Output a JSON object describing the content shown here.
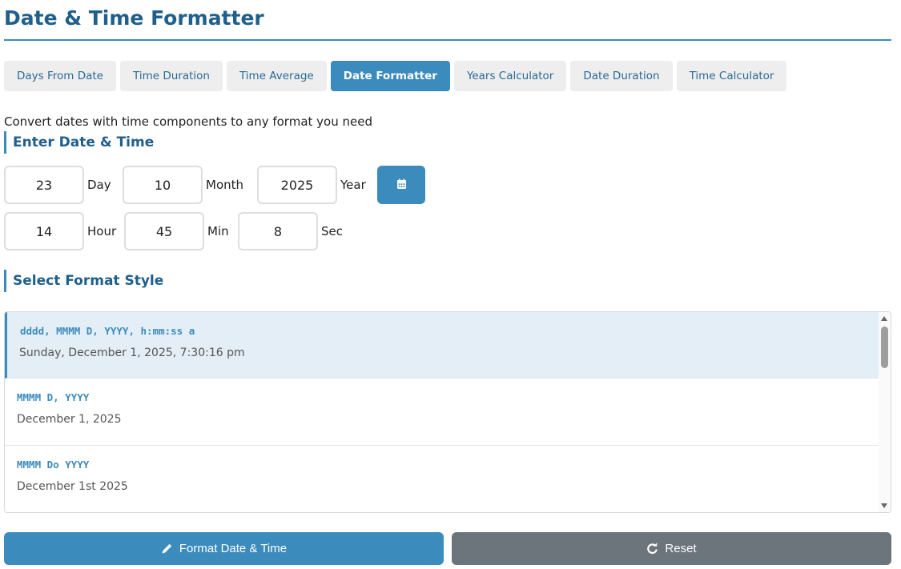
{
  "header": {
    "title": "Date & Time Formatter"
  },
  "tabs": [
    {
      "label": "Days From Date",
      "active": false
    },
    {
      "label": "Time Duration",
      "active": false
    },
    {
      "label": "Time Average",
      "active": false
    },
    {
      "label": "Date Formatter",
      "active": true
    },
    {
      "label": "Years Calculator",
      "active": false
    },
    {
      "label": "Date Duration",
      "active": false
    },
    {
      "label": "Time Calculator",
      "active": false
    }
  ],
  "intro": "Convert dates with time components to any format you need",
  "date_section": {
    "heading": "Enter Date & Time",
    "day": {
      "value": "23",
      "label": "Day"
    },
    "month": {
      "value": "10",
      "label": "Month"
    },
    "year": {
      "value": "2025",
      "label": "Year"
    },
    "hour": {
      "value": "14",
      "label": "Hour"
    },
    "minute": {
      "value": "45",
      "label": "Min"
    },
    "second": {
      "value": "8",
      "label": "Sec"
    },
    "calendar_icon": "calendar-icon"
  },
  "format_section": {
    "heading": "Select Format Style",
    "items": [
      {
        "pattern": "dddd, MMMM D, YYYY, h:mm:ss a",
        "example": "Sunday, December 1, 2025, 7:30:16 pm",
        "selected": true
      },
      {
        "pattern": "MMMM D, YYYY",
        "example": "December 1, 2025",
        "selected": false
      },
      {
        "pattern": "MMMM Do YYYY",
        "example": "December 1st 2025",
        "selected": false
      }
    ]
  },
  "actions": {
    "format_label": "Format Date & Time",
    "format_icon": "pencil-icon",
    "reset_label": "Reset",
    "reset_icon": "redo-icon"
  },
  "colors": {
    "accent": "#3b8bbd",
    "title": "#1f5f8b",
    "reset": "#6c747c"
  }
}
